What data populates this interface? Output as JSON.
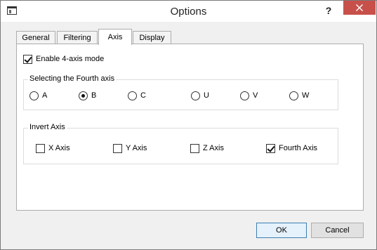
{
  "window": {
    "title": "Options",
    "help_glyph": "?",
    "close_glyph": "close"
  },
  "tabs": [
    {
      "label": "General",
      "active": false
    },
    {
      "label": "Filtering",
      "active": false
    },
    {
      "label": "Axis",
      "active": true
    },
    {
      "label": "Display",
      "active": false
    }
  ],
  "axis_tab": {
    "enable_four_axis": {
      "label": "Enable 4-axis mode",
      "checked": true
    },
    "fourth_axis_group": {
      "title": "Selecting the Fourth axis",
      "options": [
        {
          "label": "A",
          "selected": false
        },
        {
          "label": "B",
          "selected": true
        },
        {
          "label": "C",
          "selected": false
        },
        {
          "label": "U",
          "selected": false
        },
        {
          "label": "V",
          "selected": false
        },
        {
          "label": "W",
          "selected": false
        }
      ]
    },
    "invert_axis_group": {
      "title": "Invert Axis",
      "options": [
        {
          "label": "X Axis",
          "checked": false
        },
        {
          "label": "Y Axis",
          "checked": false
        },
        {
          "label": "Z Axis",
          "checked": false
        },
        {
          "label": "Fourth Axis",
          "checked": true
        }
      ]
    }
  },
  "buttons": {
    "ok_label": "OK",
    "cancel_label": "Cancel"
  },
  "colors": {
    "close_button": "#c7514a",
    "default_button_border": "#3c7fb1"
  }
}
